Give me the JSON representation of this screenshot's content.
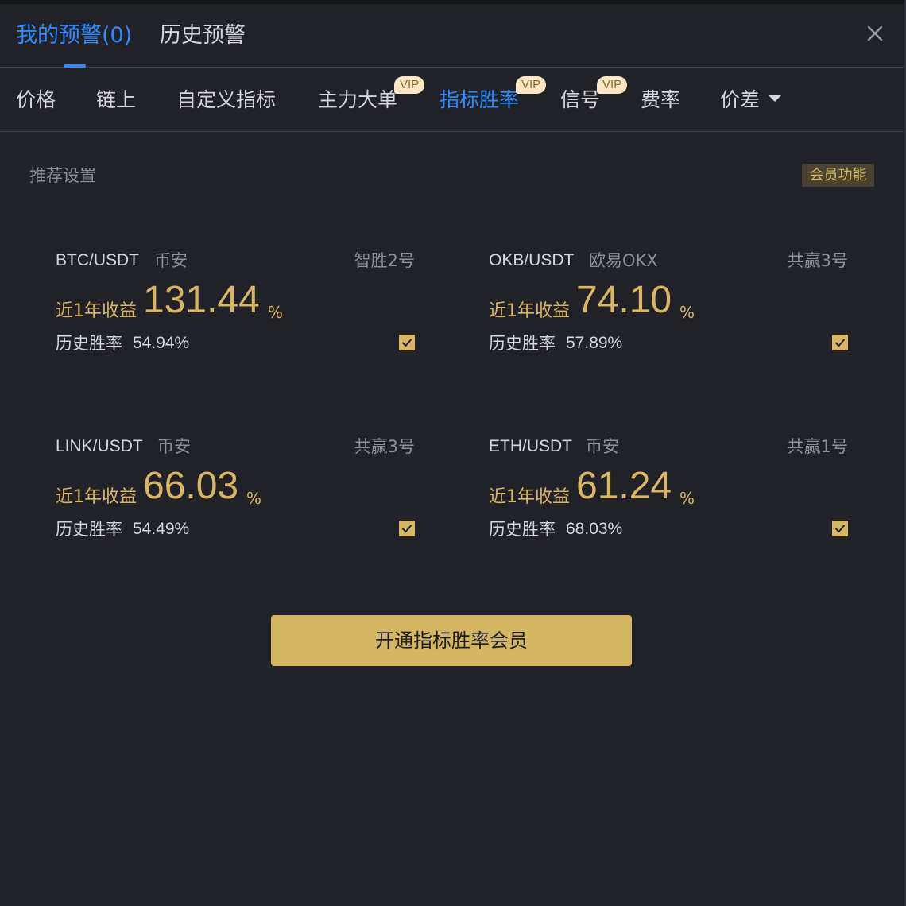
{
  "header": {
    "tabs": [
      {
        "label": "我的预警(0)",
        "active": true
      },
      {
        "label": "历史预警",
        "active": false
      }
    ],
    "close_icon": "close-icon"
  },
  "subnav": {
    "items": [
      {
        "label": "价格",
        "vip": false
      },
      {
        "label": "链上",
        "vip": false
      },
      {
        "label": "自定义指标",
        "vip": false
      },
      {
        "label": "主力大单",
        "vip": true
      },
      {
        "label": "指标胜率",
        "vip": true,
        "active": true
      },
      {
        "label": "信号",
        "vip": true
      },
      {
        "label": "费率",
        "vip": false
      },
      {
        "label": "价差",
        "vip": false,
        "dropdown": true
      }
    ],
    "vip_label": "VIP"
  },
  "section": {
    "title": "推荐设置",
    "member_badge": "会员功能"
  },
  "cards": [
    {
      "pair": "BTC/USDT",
      "exchange": "币安",
      "strategy": "智胜2号",
      "return_label": "近1年收益",
      "return_value": "131.44",
      "unit": "%",
      "winrate_label": "历史胜率",
      "winrate_value": "54.94%",
      "checked": true
    },
    {
      "pair": "OKB/USDT",
      "exchange": "欧易OKX",
      "strategy": "共赢3号",
      "return_label": "近1年收益",
      "return_value": "74.10",
      "unit": "%",
      "winrate_label": "历史胜率",
      "winrate_value": "57.89%",
      "checked": true
    },
    {
      "pair": "LINK/USDT",
      "exchange": "币安",
      "strategy": "共赢3号",
      "return_label": "近1年收益",
      "return_value": "66.03",
      "unit": "%",
      "winrate_label": "历史胜率",
      "winrate_value": "54.49%",
      "checked": true
    },
    {
      "pair": "ETH/USDT",
      "exchange": "币安",
      "strategy": "共赢1号",
      "return_label": "近1年收益",
      "return_value": "61.24",
      "unit": "%",
      "winrate_label": "历史胜率",
      "winrate_value": "68.03%",
      "checked": true
    }
  ],
  "cta": {
    "label": "开通指标胜率会员"
  },
  "colors": {
    "accent_blue": "#2c8cff",
    "gold": "#d8b764",
    "background": "#212228"
  }
}
